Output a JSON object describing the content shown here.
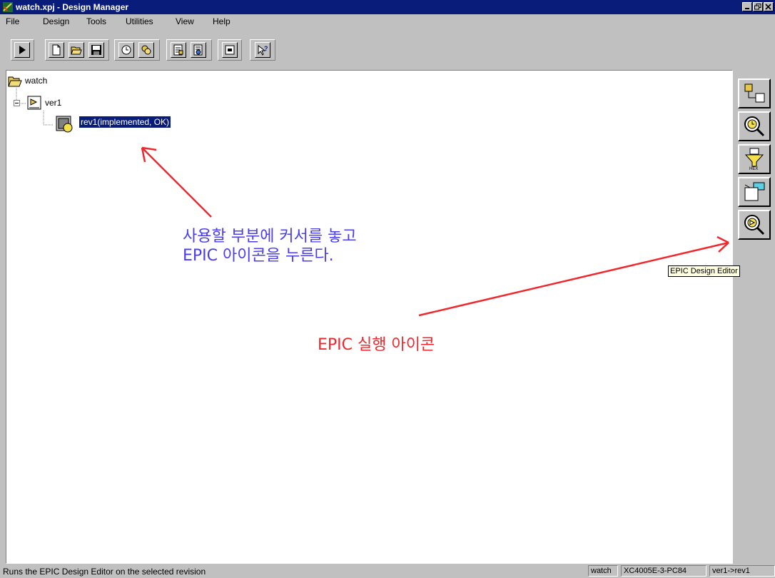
{
  "window": {
    "title": "watch.xpj - Design Manager"
  },
  "menu": {
    "items": [
      "File",
      "Design",
      "Tools",
      "Utilities",
      "View",
      "Help"
    ]
  },
  "toolbar": {
    "buttons": [
      "play-icon",
      "new-document-icon",
      "open-folder-icon",
      "save-icon",
      "clock-icon",
      "folders-icon",
      "report-icon",
      "report-detail-icon",
      "options-icon",
      "context-help-icon"
    ]
  },
  "tree": {
    "project": "watch",
    "version": "ver1",
    "revision": "rev1(implemented, OK)"
  },
  "side_tools": {
    "buttons": [
      "flow-engine-icon",
      "timing-analyzer-icon",
      "prom-file-formatter-icon",
      "hardware-debugger-icon",
      "epic-design-editor-icon"
    ],
    "tooltip": "EPIC Design Editor"
  },
  "annotations": {
    "instruction_line1": "사용할 부분에 커서를 놓고",
    "instruction_line2": "EPIC 아이콘을 누른다.",
    "epic_label": "EPIC 실행 아이콘",
    "instruction_color": "#4a3cf0",
    "epic_color": "#f0282d",
    "arrow_color": "#f0282d"
  },
  "status": {
    "text": "Runs the EPIC Design Editor on the selected revision",
    "project": "watch",
    "device": "XC4005E-3-PC84",
    "revision_path": "ver1->rev1"
  }
}
